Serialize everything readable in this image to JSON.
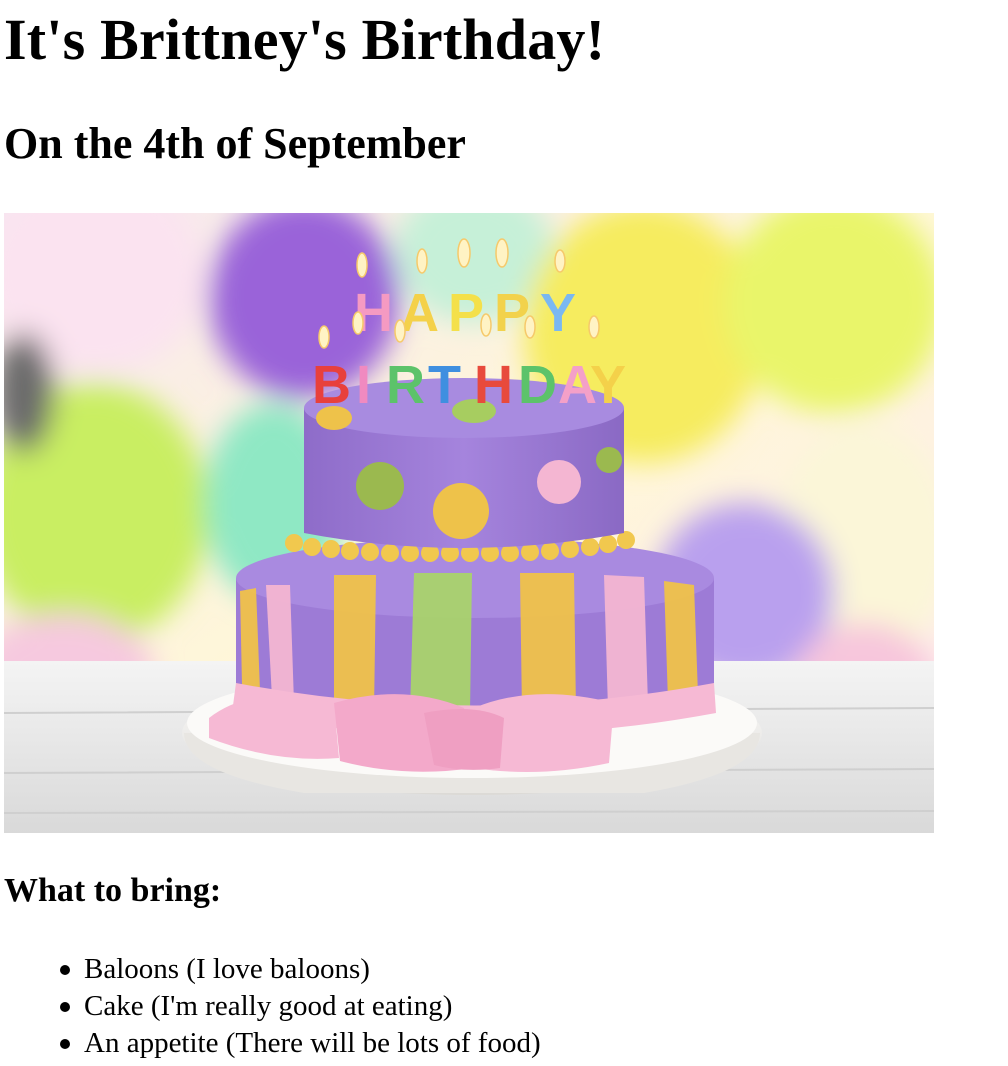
{
  "heading": "It's Brittney's Birthday!",
  "subheading": "On the 4th of September",
  "image": {
    "subject": "birthday-cake-photo",
    "candle_letters_top": [
      "H",
      "A",
      "P",
      "P",
      "Y"
    ],
    "candle_letters_bottom": [
      "B",
      "I",
      "R",
      "T",
      "H",
      "D",
      "A",
      "Y"
    ],
    "colors": {
      "cake_purple": "#9d7bd6",
      "stripe_yellow": "#f0c24a",
      "stripe_green": "#a9d36b",
      "stripe_pink": "#f4b6d2",
      "ribbon_pink": "#f6b9d4",
      "stand_white": "#f5f3f0"
    }
  },
  "bring_title": "What to bring:",
  "bring_items": [
    "Baloons (I love baloons)",
    "Cake (I'm really good at eating)",
    "An appetite (There will be lots of food)"
  ]
}
